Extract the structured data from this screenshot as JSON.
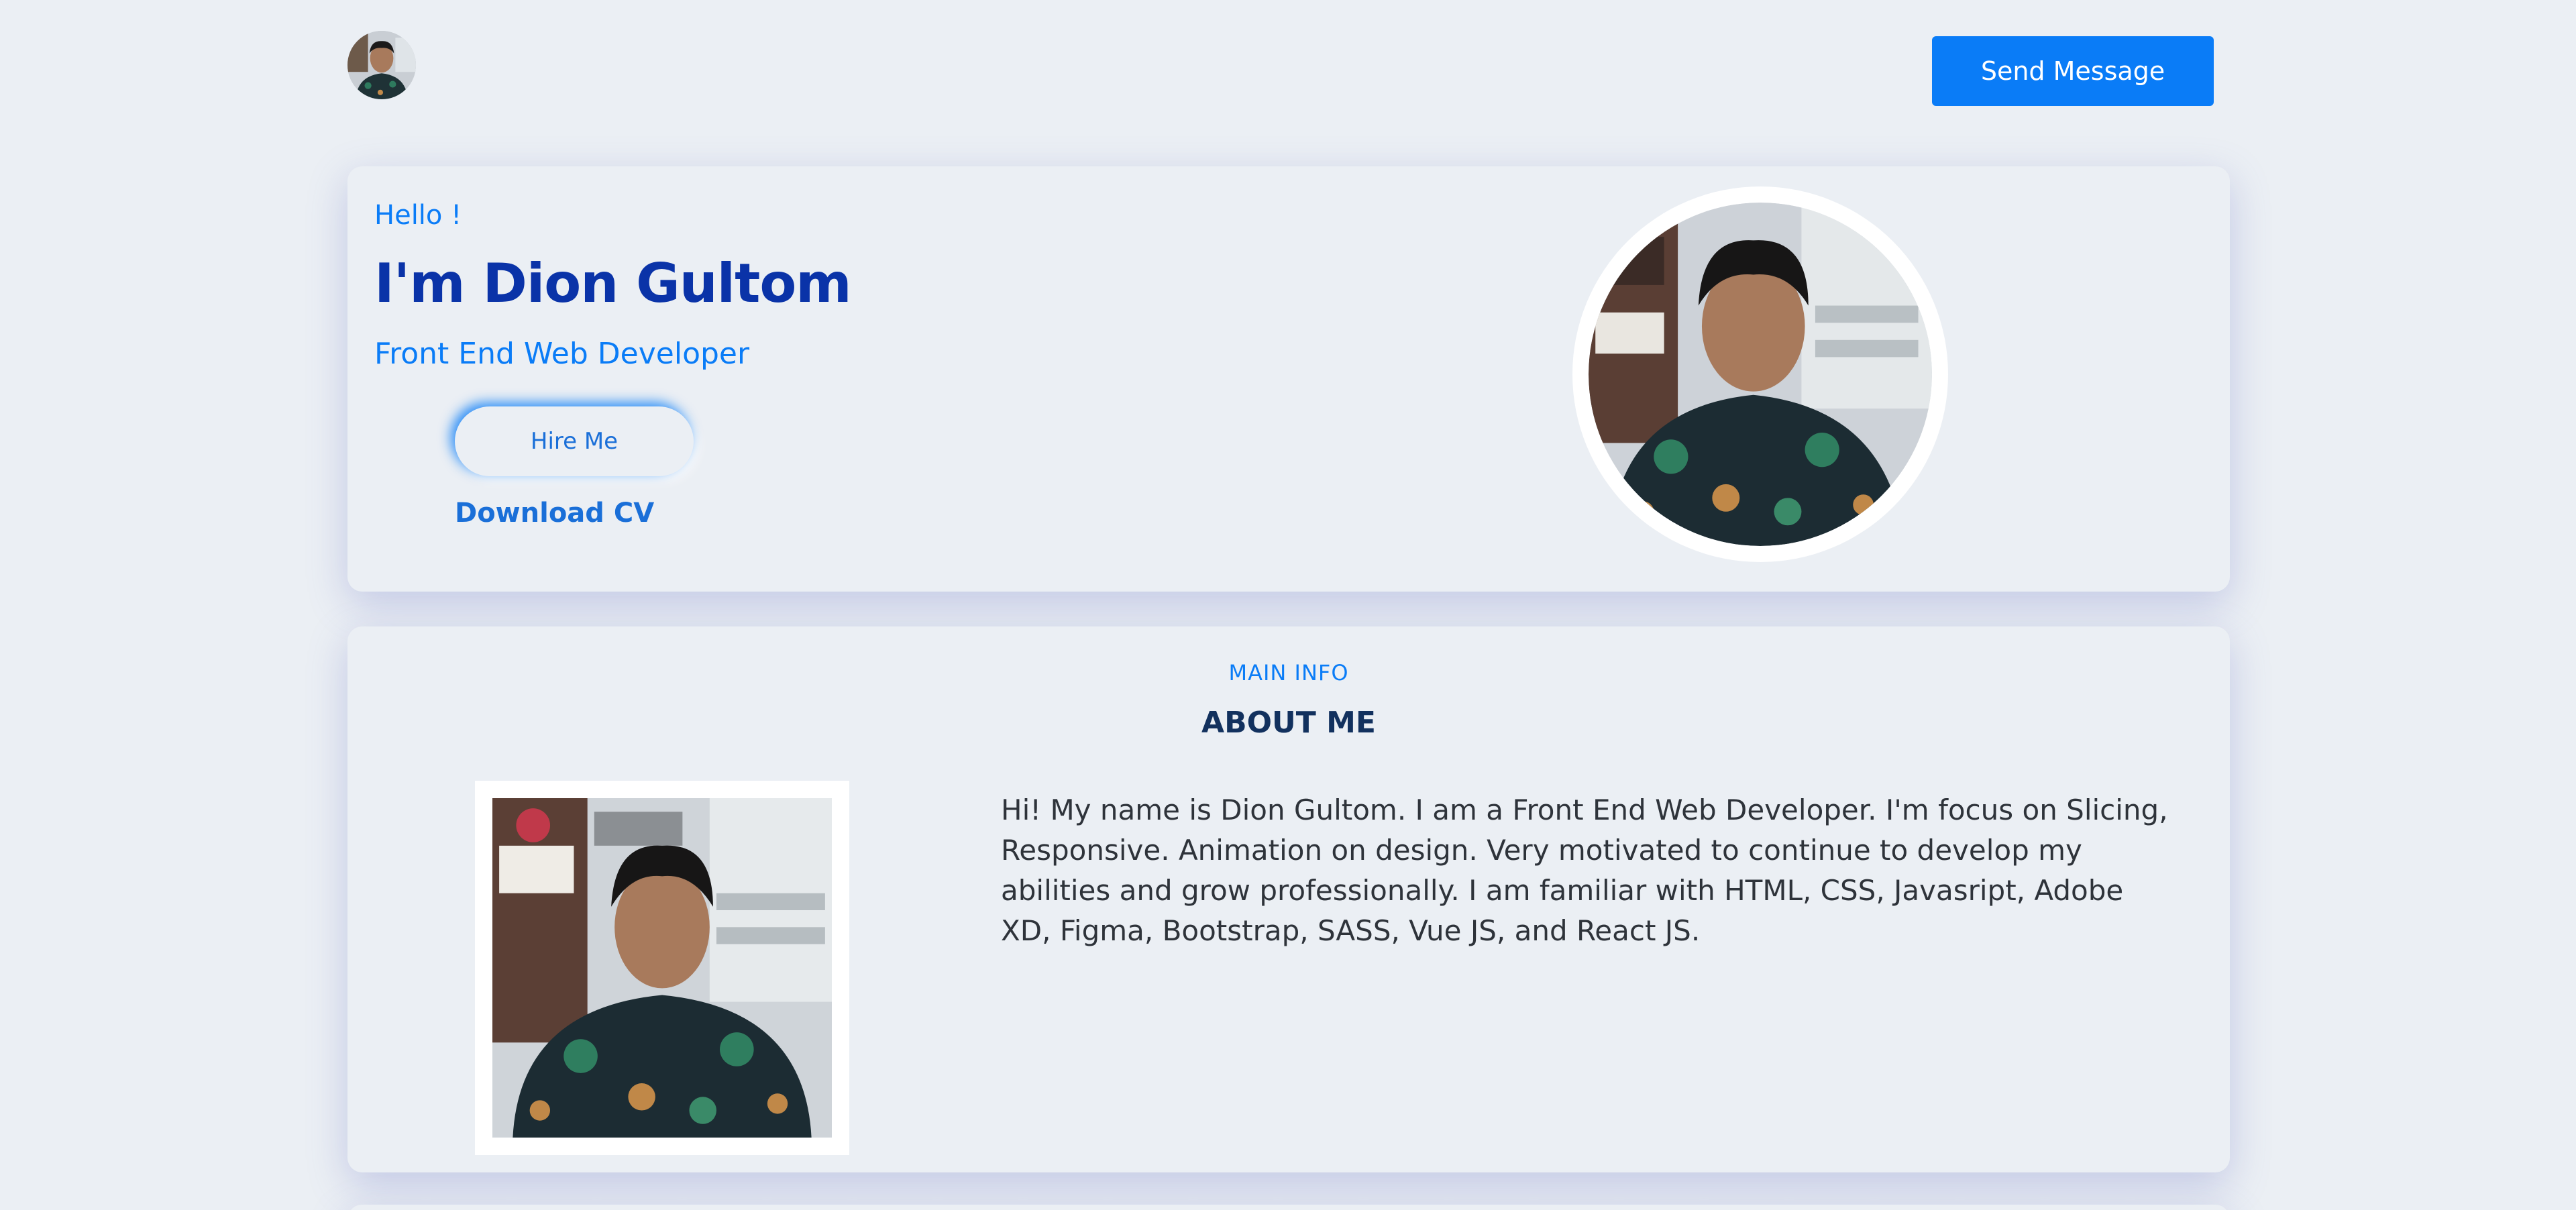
{
  "header": {
    "avatar_alt": "profile photo",
    "send_label": "Send Message"
  },
  "hero": {
    "greeting": "Hello !",
    "name": "I'm Dion Gultom",
    "role": "Front End Web Developer",
    "hire_label": "Hire Me",
    "download_label": "Download CV"
  },
  "about": {
    "kicker": "MAIN INFO",
    "title": "ABOUT ME",
    "text": "Hi! My name is Dion Gultom. I am a Front End Web Developer. I'm focus on Slicing, Responsive. Animation on design. Very motivated to continue to develop my abilities and grow professionally. I am familiar with HTML, CSS, Javasript, Adobe XD, Figma, Bootstrap, SASS, Vue JS, and React JS."
  },
  "colors": {
    "background": "#ebeff4",
    "accent": "#0a7cf7",
    "name": "#0a33a8",
    "heading": "#12315e"
  }
}
